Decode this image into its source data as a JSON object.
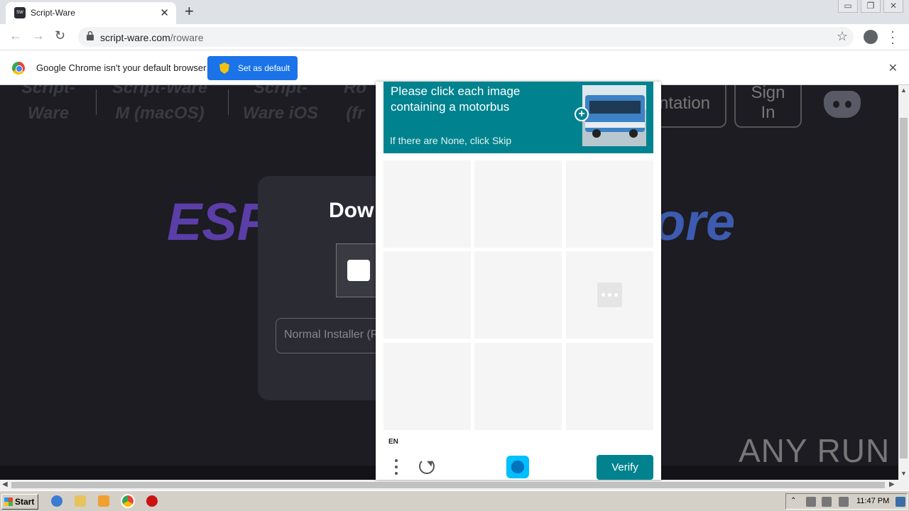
{
  "browser": {
    "tab_title": "Script-Ware",
    "url_host": "script-ware.com",
    "url_path": "/roware",
    "infobar_text": "Google Chrome isn't your default browser",
    "set_default_label": "Set as default"
  },
  "site": {
    "nav": [
      "Script-\nWare",
      "Script-Ware\nM (macOS)",
      "Script-\nWare iOS",
      "Ro\n(fr"
    ],
    "docs_label": "ntation",
    "signin_label": "Sign\nIn",
    "hero_left": "ESP",
    "hero_right": "ore",
    "card_title": "Dow",
    "select_text": "Normal Installer (Re"
  },
  "captcha": {
    "prompt": "Please click each image containing a motorbus",
    "sub": "If there are None, click Skip",
    "lang": "EN",
    "verify_label": "Verify"
  },
  "watermark": "ANY RUN",
  "taskbar": {
    "start_label": "Start",
    "clock": "11:47 PM"
  }
}
